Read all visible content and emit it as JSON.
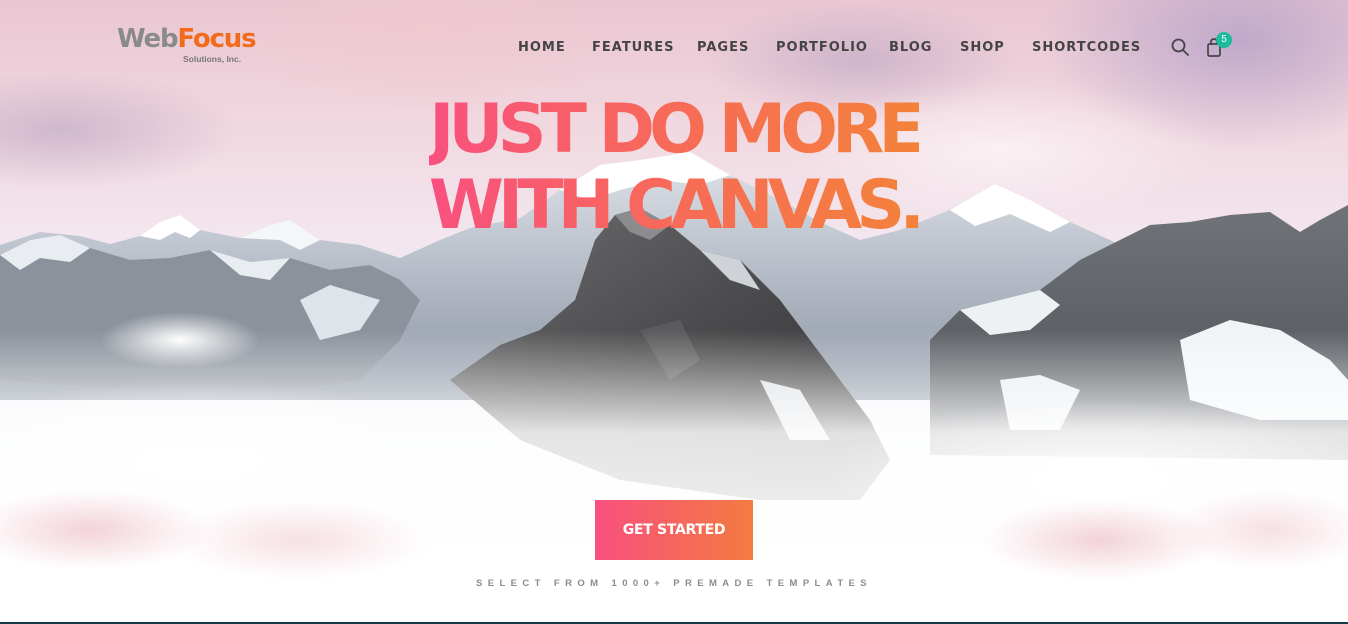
{
  "brand": {
    "word_part1": "Web",
    "word_part2": "Focus",
    "tagline": "Solutions, Inc."
  },
  "nav": {
    "items": [
      {
        "label": "HOME"
      },
      {
        "label": "FEATURES"
      },
      {
        "label": "PAGES"
      },
      {
        "label": "PORTFOLIO"
      },
      {
        "label": "BLOG"
      },
      {
        "label": "SHOP"
      },
      {
        "label": "SHORTCODES"
      }
    ],
    "search_icon": "search-icon",
    "cart_icon": "shopping-bag-icon",
    "cart_count": "5"
  },
  "hero": {
    "headline_line1": "JUST DO MORE",
    "headline_line2": "WITH CANVAS.",
    "cta_label": "GET STARTED",
    "subtext": "SELECT FROM 1000+ PREMADE TEMPLATES",
    "background": "snowy mountain peaks above clouds under a pink sky"
  },
  "colors": {
    "gradient_start": "#f9507f",
    "gradient_end": "#f37b40",
    "badge": "#1abc9c",
    "nav_text": "#444444",
    "logo_grey": "#8a8a8a",
    "logo_orange": "#f26a1b"
  }
}
